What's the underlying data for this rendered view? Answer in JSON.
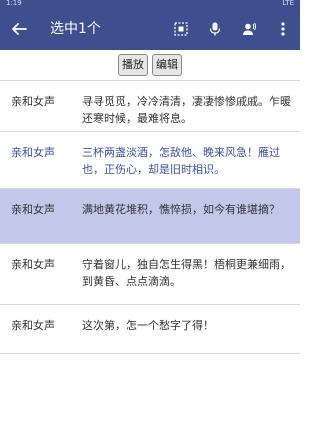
{
  "status_bar": {
    "time": "1:19",
    "right": "LTE"
  },
  "app_bar": {
    "title": "选中1个",
    "icons": [
      "back-arrow-icon",
      "select-all-icon",
      "microphone-icon",
      "voice-person-icon",
      "more-vert-icon"
    ]
  },
  "toolbar": {
    "play_label": "播放",
    "edit_label": "编辑"
  },
  "rows": [
    {
      "voice": "亲和女声",
      "text": "寻寻觅觅，冷冷清清，凄凄惨惨戚戚。乍暖还寒时候，最难将息。"
    },
    {
      "voice": "亲和女声",
      "text": "三杯两盏淡酒，怎敌他、晚来风急！雁过也，正伤心，却是旧时相识。",
      "state": "playing"
    },
    {
      "voice": "亲和女声",
      "text": "满地黄花堆积，憔悴损，如今有谁堪摘？",
      "state": "selected"
    },
    {
      "voice": "亲和女声",
      "text": "守着窗儿，独自怎生得黑！梧桐更兼细雨，到黄昏、点点滴滴。"
    },
    {
      "voice": "亲和女声",
      "text": "这次第，怎一个愁字了得！"
    }
  ],
  "colors": {
    "primary": "#3f4e8e",
    "selected_row": "#c3c7ea",
    "playing_text": "#3f4e9a"
  }
}
